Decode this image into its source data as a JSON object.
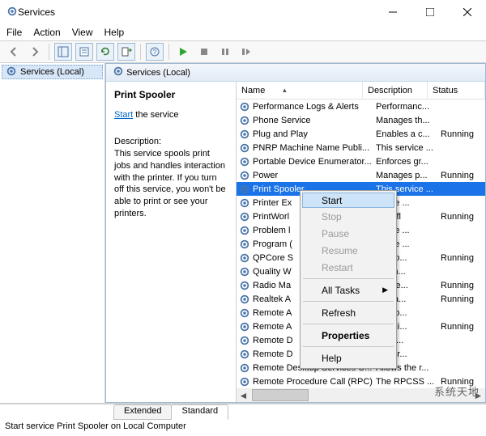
{
  "window": {
    "title": "Services"
  },
  "menu": {
    "file": "File",
    "action": "Action",
    "view": "View",
    "help": "Help"
  },
  "tree": {
    "root": "Services (Local)"
  },
  "rightHeader": {
    "label": "Services (Local)"
  },
  "detail": {
    "title": "Print Spooler",
    "startLabel": "Start",
    "serviceSuffix": " the service",
    "descLabel": "Description:",
    "descText": "This service spools print jobs and handles interaction with the printer. If you turn off this service, you won't be able to print or see your printers."
  },
  "columns": {
    "name": "Name",
    "desc": "Description",
    "status": "Status"
  },
  "services": [
    {
      "name": "Performance Logs & Alerts",
      "desc": "Performanc...",
      "status": ""
    },
    {
      "name": "Phone Service",
      "desc": "Manages th...",
      "status": ""
    },
    {
      "name": "Plug and Play",
      "desc": "Enables a c...",
      "status": "Running"
    },
    {
      "name": "PNRP Machine Name Publi...",
      "desc": "This service ...",
      "status": ""
    },
    {
      "name": "Portable Device Enumerator...",
      "desc": "Enforces gr...",
      "status": ""
    },
    {
      "name": "Power",
      "desc": "Manages p...",
      "status": "Running"
    },
    {
      "name": "Print Spooler",
      "desc": "This service ...",
      "status": "",
      "selected": true
    },
    {
      "name": "Printer Ex",
      "desc": "ervice ...",
      "status": ""
    },
    {
      "name": "PrintWorl",
      "desc": "Workfl",
      "status": "Running"
    },
    {
      "name": "Problem l",
      "desc": "ervice ...",
      "status": ""
    },
    {
      "name": "Program (",
      "desc": "ervice ...",
      "status": ""
    },
    {
      "name": "QPCore S",
      "desc": "nt Pro...",
      "status": "Running"
    },
    {
      "name": "Quality W",
      "desc": "y Win...",
      "status": ""
    },
    {
      "name": "Radio Ma",
      "desc": "anage...",
      "status": "Running"
    },
    {
      "name": "Realtek A",
      "desc": "opera...",
      "status": "Running"
    },
    {
      "name": "Remote A",
      "desc": "s a co...",
      "status": ""
    },
    {
      "name": "Remote A",
      "desc": "ges di...",
      "status": "Running"
    },
    {
      "name": "Remote D",
      "desc": "Desk...",
      "status": ""
    },
    {
      "name": "Remote D",
      "desc": "s user...",
      "status": ""
    },
    {
      "name": "Remote Desktop Services U...",
      "desc": "Allows the r...",
      "status": ""
    },
    {
      "name": "Remote Procedure Call (RPC)",
      "desc": "The RPCSS ...",
      "status": "Running"
    }
  ],
  "context": {
    "start": "Start",
    "stop": "Stop",
    "pause": "Pause",
    "resume": "Resume",
    "restart": "Restart",
    "alltasks": "All Tasks",
    "refresh": "Refresh",
    "properties": "Properties",
    "help": "Help"
  },
  "tabs": {
    "extended": "Extended",
    "standard": "Standard"
  },
  "statusbar": "Start service Print Spooler on Local Computer",
  "watermark": "系统天地"
}
